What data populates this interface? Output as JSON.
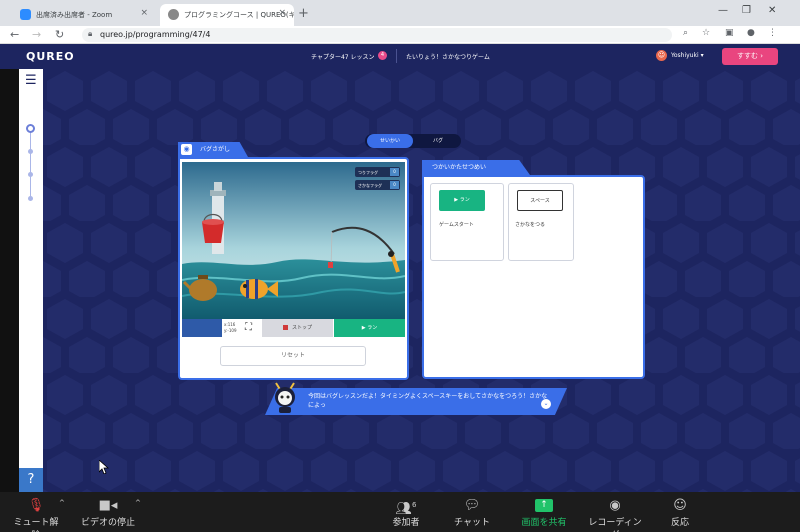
{
  "browser": {
    "tabs": [
      {
        "title": "出席済み出席者 - Zoom",
        "close": "×"
      },
      {
        "title": "プログラミングコース | QUREO(キュレオ)",
        "close": "×"
      }
    ],
    "new_tab": "+",
    "window_controls": {
      "minimize": "—",
      "maximize": "❐",
      "close": "✕"
    },
    "url": "qureo.jp/programming/47/4",
    "nav": {
      "back": "←",
      "forward": "→",
      "reload": "↻"
    }
  },
  "header": {
    "logo": "QUREO",
    "chapter_label": "チャプター47 レッスン",
    "lesson_number": "4",
    "lesson_title": "たいりょう！さかなつりゲーム",
    "username": "Yoshiyuki",
    "user_caret": "▾",
    "next_button": "すすむ ›"
  },
  "sidebar": {
    "menu_icon": "☰",
    "help": "?",
    "progress_total": 4,
    "progress_current": 1
  },
  "mode_toggle": {
    "options": [
      "せいかい",
      "バグ"
    ],
    "selected": "せいかい"
  },
  "bug_panel": {
    "title": "バグさがし",
    "flags": [
      {
        "label": "つりフラグ",
        "value": "0"
      },
      {
        "label": "さかなフラグ",
        "value": "0"
      }
    ],
    "coords": {
      "x": "x:116",
      "y": "y:-109"
    },
    "fullscreen_icon": "⛶",
    "stop_label": "ストップ",
    "run_label": "▶ ラン",
    "reset_label": "リセット"
  },
  "usage_panel": {
    "title": "つかいかたせつめい",
    "cards": [
      {
        "block": "▶ ラン",
        "caption": "ゲームスタート"
      },
      {
        "block": "スペース",
        "caption": "さかなをつる"
      }
    ]
  },
  "hint": {
    "text": "今回はバグレッスンだよ！タイミングよくスペースキーをおしてさかなをつろう！さかなによっ",
    "more_icon": "⌄"
  },
  "zoom_toolbar": {
    "mute": "ミュート解除",
    "video": "ビデオの停止",
    "participants": "参加者",
    "participant_count": "6",
    "chat": "チャット",
    "share": "画面を共有",
    "record": "レコーディング",
    "reactions": "反応"
  },
  "colors": {
    "stage_bg": "#1d2560",
    "accent_blue": "#3a6ee8",
    "run_green": "#18b482",
    "next_pink": "#e9457f",
    "zoom_green": "#21c36a"
  }
}
